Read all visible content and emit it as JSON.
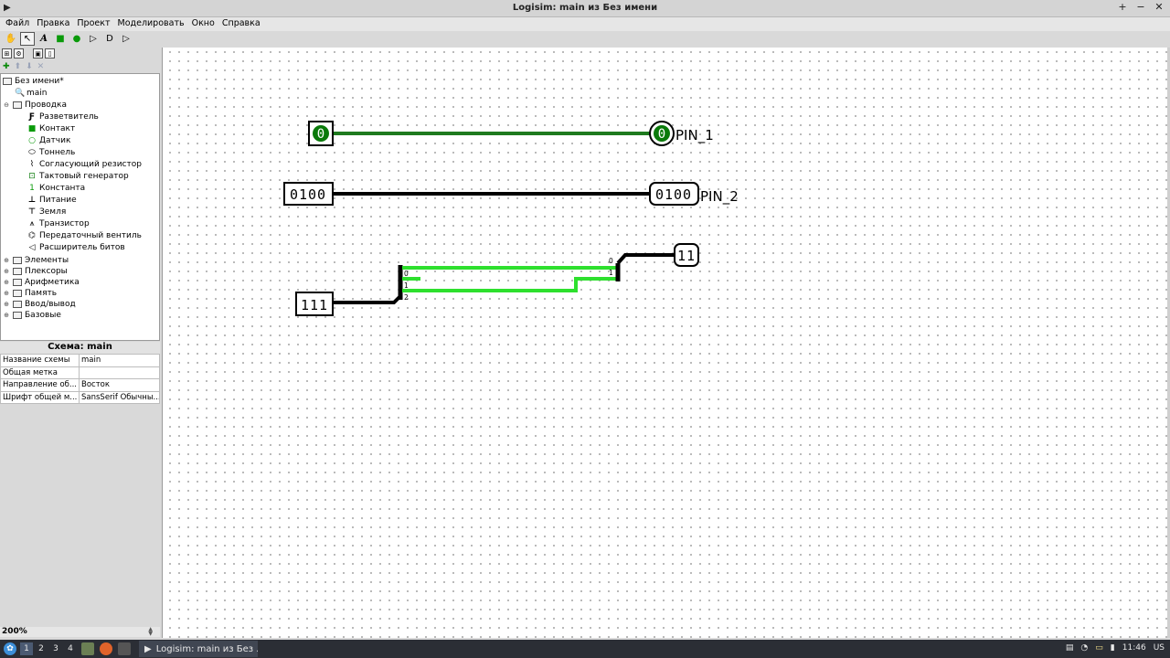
{
  "window": {
    "title": "Logisim: main из Без имени",
    "app_icon": "app-icon",
    "controls": [
      "+",
      "−",
      "✕"
    ]
  },
  "menubar": [
    "Файл",
    "Правка",
    "Проект",
    "Моделировать",
    "Окно",
    "Справка"
  ],
  "toolbar": [
    {
      "icon": "hand-poke-icon",
      "glyph": "✋"
    },
    {
      "icon": "select-arrow-icon",
      "glyph": "↖"
    },
    {
      "icon": "text-tool-icon",
      "glyph": "A"
    },
    {
      "icon": "input-pin-icon",
      "glyph": "■"
    },
    {
      "icon": "output-pin-icon",
      "glyph": "●"
    },
    {
      "icon": "not-gate-icon",
      "glyph": "▷"
    },
    {
      "icon": "and-gate-icon",
      "glyph": "D"
    },
    {
      "icon": "or-gate-icon",
      "glyph": "▷"
    }
  ],
  "explorer": {
    "project": "Без имени*",
    "circuit": "main",
    "wiring": {
      "label": "Проводка",
      "items": [
        {
          "label": "Разветвитель",
          "icon": "splitter-icon",
          "glyph": "Ƒ"
        },
        {
          "label": "Контакт",
          "icon": "pin-icon",
          "glyph": "■"
        },
        {
          "label": "Датчик",
          "icon": "probe-icon",
          "glyph": "○"
        },
        {
          "label": "Тоннель",
          "icon": "tunnel-icon",
          "glyph": "⬭"
        },
        {
          "label": "Согласующий резистор",
          "icon": "pull-resistor-icon",
          "glyph": "⌇"
        },
        {
          "label": "Тактовый генератор",
          "icon": "clock-icon",
          "glyph": "⊡"
        },
        {
          "label": "Константа",
          "icon": "constant-icon",
          "glyph": "1"
        },
        {
          "label": "Питание",
          "icon": "power-icon",
          "glyph": "⊥"
        },
        {
          "label": "Земля",
          "icon": "ground-icon",
          "glyph": "⊤"
        },
        {
          "label": "Транзистор",
          "icon": "transistor-icon",
          "glyph": "⩚"
        },
        {
          "label": "Передаточный вентиль",
          "icon": "transmission-gate-icon",
          "glyph": "⌬"
        },
        {
          "label": "Расширитель битов",
          "icon": "bit-extender-icon",
          "glyph": "◁"
        }
      ]
    },
    "libraries": [
      "Элементы",
      "Плексоры",
      "Арифметика",
      "Память",
      "Ввод/вывод",
      "Базовые"
    ]
  },
  "attributes": {
    "header": "Схема: main",
    "rows": [
      {
        "key": "Название схемы",
        "value": "main"
      },
      {
        "key": "Общая метка",
        "value": ""
      },
      {
        "key": "Направление об...",
        "value": "Восток"
      },
      {
        "key": "Шрифт общей м...",
        "value": "SansSerif Обычны..."
      }
    ]
  },
  "zoom": "200%",
  "circuit": {
    "pin1_in": "0",
    "pin1_out": "0",
    "pin1_label": "PIN_1",
    "pin2_in": "0100",
    "pin2_out": "0100",
    "pin2_label": "PIN_2",
    "pin3_in": "111",
    "pin3_out": "11",
    "split_in_0": "0",
    "split_in_1": "1",
    "split_in_2": "2",
    "split_out_0": "0",
    "split_out_1": "1",
    "colors": {
      "wire_active": "#1e9a1e",
      "wire_bus_green": "#2ee02e",
      "wire_bus": "#000000",
      "pin_fill": "#0a7a0a"
    }
  },
  "taskbar": {
    "workspaces": [
      "1",
      "2",
      "3",
      "4"
    ],
    "task_label": "Logisim: main из Без ...",
    "clock": "11:46",
    "layout": "US"
  }
}
